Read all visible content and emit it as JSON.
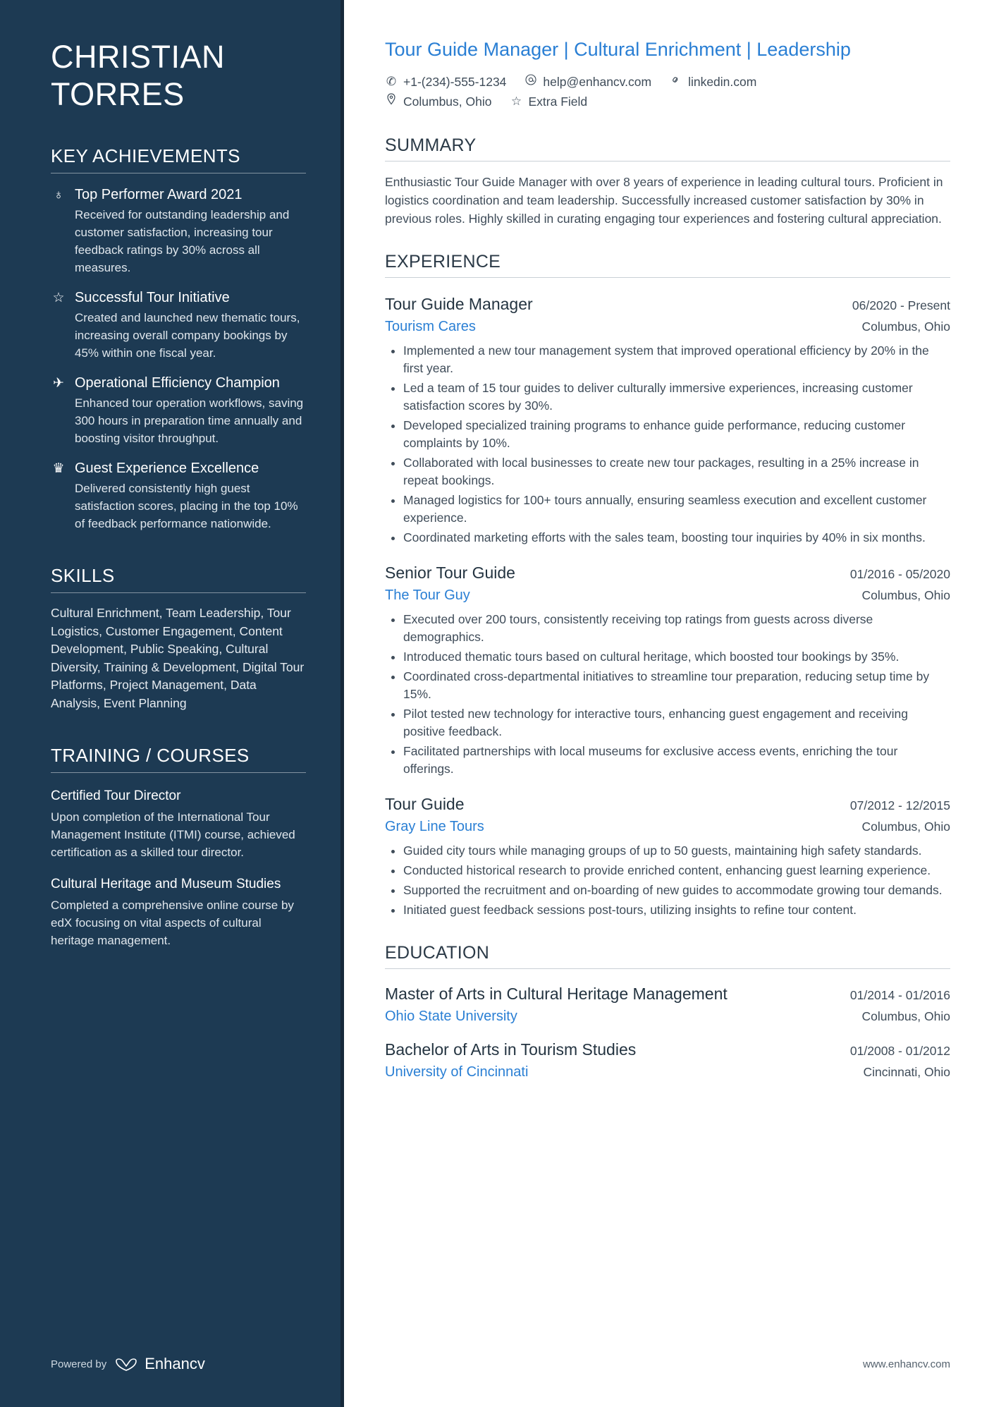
{
  "sidebar": {
    "name_line1": "CHRISTIAN",
    "name_line2": "TORRES",
    "achievements_title": "KEY ACHIEVEMENTS",
    "achievements": [
      {
        "icon": "award-ribbon-icon",
        "glyph": "♁",
        "title": "Top Performer Award 2021",
        "desc": "Received for outstanding leadership and customer satisfaction, increasing tour feedback ratings by 30% across all measures."
      },
      {
        "icon": "star-icon",
        "glyph": "☆",
        "title": "Successful Tour Initiative",
        "desc": "Created and launched new thematic tours, increasing overall company bookings by 45% within one fiscal year."
      },
      {
        "icon": "rocket-icon",
        "glyph": "✈",
        "title": "Operational Efficiency Champion",
        "desc": "Enhanced tour operation workflows, saving 300 hours in preparation time annually and boosting visitor throughput."
      },
      {
        "icon": "trophy-icon",
        "glyph": "♛",
        "title": "Guest Experience Excellence",
        "desc": "Delivered consistently high guest satisfaction scores, placing in the top 10% of feedback performance nationwide."
      }
    ],
    "skills_title": "SKILLS",
    "skills_text": "Cultural Enrichment, Team Leadership, Tour Logistics, Customer Engagement, Content Development, Public Speaking, Cultural Diversity, Training & Development, Digital Tour Platforms, Project Management, Data Analysis, Event Planning",
    "training_title": "TRAINING / COURSES",
    "courses": [
      {
        "title": "Certified Tour Director",
        "desc": "Upon completion of the International Tour Management Institute (ITMI) course, achieved certification as a skilled tour director."
      },
      {
        "title": "Cultural Heritage and Museum Studies",
        "desc": "Completed a comprehensive online course by edX focusing on vital aspects of cultural heritage management."
      }
    ],
    "powered_by": "Powered by",
    "brand": "Enhancv"
  },
  "main": {
    "headline": "Tour Guide Manager | Cultural Enrichment | Leadership",
    "contacts": [
      {
        "icon": "phone-icon",
        "glyph": "✆",
        "text": "+1-(234)-555-1234"
      },
      {
        "icon": "email-icon",
        "glyph": "@",
        "text": "help@enhancv.com"
      },
      {
        "icon": "link-icon",
        "glyph": "⚗",
        "text": "linkedin.com"
      }
    ],
    "contacts_row2": [
      {
        "icon": "location-pin-icon",
        "glyph": "⚑",
        "text": "Columbus, Ohio"
      },
      {
        "icon": "star-outline-icon",
        "glyph": "☆",
        "text": "Extra Field"
      }
    ],
    "summary_title": "SUMMARY",
    "summary_text": "Enthusiastic Tour Guide Manager with over 8 years of experience in leading cultural tours. Proficient in logistics coordination and team leadership. Successfully increased customer satisfaction by 30% in previous roles. Highly skilled in curating engaging tour experiences and fostering cultural appreciation.",
    "experience_title": "EXPERIENCE",
    "jobs": [
      {
        "title": "Tour Guide Manager",
        "date": "06/2020 - Present",
        "company": "Tourism Cares",
        "location": "Columbus, Ohio",
        "bullets": [
          "Implemented a new tour management system that improved operational efficiency by 20% in the first year.",
          "Led a team of 15 tour guides to deliver culturally immersive experiences, increasing customer satisfaction scores by 30%.",
          "Developed specialized training programs to enhance guide performance, reducing customer complaints by 10%.",
          "Collaborated with local businesses to create new tour packages, resulting in a 25% increase in repeat bookings.",
          "Managed logistics for 100+ tours annually, ensuring seamless execution and excellent customer experience.",
          "Coordinated marketing efforts with the sales team, boosting tour inquiries by 40% in six months."
        ]
      },
      {
        "title": "Senior Tour Guide",
        "date": "01/2016 - 05/2020",
        "company": "The Tour Guy",
        "location": "Columbus, Ohio",
        "bullets": [
          "Executed over 200 tours, consistently receiving top ratings from guests across diverse demographics.",
          "Introduced thematic tours based on cultural heritage, which boosted tour bookings by 35%.",
          "Coordinated cross-departmental initiatives to streamline tour preparation, reducing setup time by 15%.",
          "Pilot tested new technology for interactive tours, enhancing guest engagement and receiving positive feedback.",
          "Facilitated partnerships with local museums for exclusive access events, enriching the tour offerings."
        ]
      },
      {
        "title": "Tour Guide",
        "date": "07/2012 - 12/2015",
        "company": "Gray Line Tours",
        "location": "Columbus, Ohio",
        "bullets": [
          "Guided city tours while managing groups of up to 50 guests, maintaining high safety standards.",
          "Conducted historical research to provide enriched content, enhancing guest learning experience.",
          "Supported the recruitment and on-boarding of new guides to accommodate growing tour demands.",
          "Initiated guest feedback sessions post-tours, utilizing insights to refine tour content."
        ]
      }
    ],
    "education_title": "EDUCATION",
    "education": [
      {
        "degree": "Master of Arts in Cultural Heritage Management",
        "date": "01/2014 - 01/2016",
        "school": "Ohio State University",
        "location": "Columbus, Ohio"
      },
      {
        "degree": "Bachelor of Arts in Tourism Studies",
        "date": "01/2008 - 01/2012",
        "school": "University of Cincinnati",
        "location": "Cincinnati, Ohio"
      }
    ],
    "website": "www.enhancv.com"
  }
}
